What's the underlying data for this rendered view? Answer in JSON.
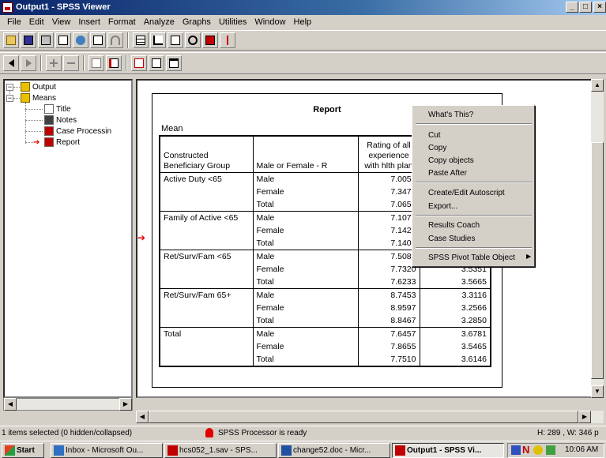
{
  "window": {
    "title": "Output1 - SPSS Viewer",
    "min": "_",
    "max": "□",
    "close": "×"
  },
  "menubar": [
    "File",
    "Edit",
    "View",
    "Insert",
    "Format",
    "Analyze",
    "Graphs",
    "Utilities",
    "Window",
    "Help"
  ],
  "toolbar1_icons": [
    "open-icon",
    "save-icon",
    "print-icon",
    "print-preview-icon",
    "export-icon",
    "dialog-recall-icon",
    "undo-icon",
    "goto-data-icon",
    "goto-case-icon",
    "variables-icon",
    "use-sets-icon",
    "show-all-icon",
    "select-last-output-icon"
  ],
  "toolbar2_icons": [
    "promote-icon",
    "demote-icon",
    "expand-icon",
    "collapse-icon",
    "show-icon",
    "hide-icon",
    "insert-heading-icon",
    "insert-title-icon",
    "insert-text-icon"
  ],
  "outline": {
    "root": "Output",
    "group": "Means",
    "items": [
      "Title",
      "Notes",
      "Case Processin",
      "Report"
    ]
  },
  "report": {
    "title": "Report",
    "statistic": "Mean",
    "headers": [
      "Constructed Beneficiary Group",
      "Male or Female  - R",
      "Rating of all experience with hlth plan"
    ],
    "groups": [
      {
        "name": "Active Duty <65",
        "rows": [
          [
            "Male",
            "7.0052",
            ""
          ],
          [
            "Female",
            "7.3471",
            ""
          ],
          [
            "Total",
            "7.0657",
            ""
          ]
        ]
      },
      {
        "name": "Family of Active <65",
        "rows": [
          [
            "Male",
            "7.1077",
            ""
          ],
          [
            "Female",
            "7.1425",
            ""
          ],
          [
            "Total",
            "7.1404",
            ""
          ]
        ]
      },
      {
        "name": "Ret/Surv/Fam <65",
        "rows": [
          [
            "Male",
            "7.5083",
            ""
          ],
          [
            "Female",
            "7.7320",
            "3.5351"
          ],
          [
            "Total",
            "7.6233",
            "3.5665"
          ]
        ]
      },
      {
        "name": "Ret/Surv/Fam 65+",
        "rows": [
          [
            "Male",
            "8.7453",
            "3.3116"
          ],
          [
            "Female",
            "8.9597",
            "3.2566"
          ],
          [
            "Total",
            "8.8467",
            "3.2850"
          ]
        ]
      },
      {
        "name": "Total",
        "rows": [
          [
            "Male",
            "7.6457",
            "3.6781"
          ],
          [
            "Female",
            "7.8655",
            "3.5465"
          ],
          [
            "Total",
            "7.7510",
            "3.6146"
          ]
        ]
      }
    ]
  },
  "context_menu": {
    "items": [
      "What's This?",
      "Cut",
      "Copy",
      "Copy objects",
      "Paste After",
      "Create/Edit Autoscript",
      "Export...",
      "Results Coach",
      "Case Studies",
      "SPSS Pivot Table Object"
    ]
  },
  "status": {
    "selection": "1 items selected (0 hidden/collapsed)",
    "processor": "SPSS Processor  is ready",
    "size": "H: 289 , W: 346 p"
  },
  "taskbar": {
    "start": "Start",
    "tasks": [
      "Inbox - Microsoft Ou...",
      "hcs052_1.sav - SPS...",
      "change52.doc - Micr...",
      "Output1 - SPSS Vi..."
    ],
    "clock": "10:06 AM"
  },
  "colors": {
    "title_blue": "#0a246a",
    "arrow_red": "#e00000",
    "spss_red": "#c00000"
  }
}
